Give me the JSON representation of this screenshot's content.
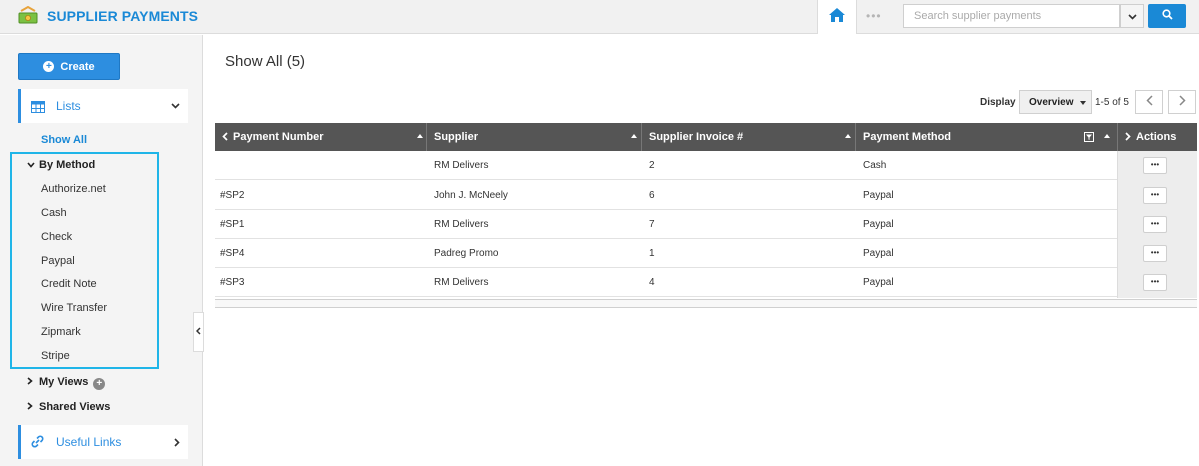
{
  "app": {
    "title": "SUPPLIER PAYMENTS",
    "logo_icon": "money-hand-icon"
  },
  "topbar": {
    "more_label": "•••",
    "search_placeholder": "Search supplier payments"
  },
  "sidebar": {
    "create_label": "Create",
    "lists_label": "Lists",
    "show_all_label": "Show All",
    "by_method_label": "By Method",
    "methods": [
      "Authorize.net",
      "Cash",
      "Check",
      "Paypal",
      "Credit Note",
      "Wire Transfer",
      "Zipmark",
      "Stripe"
    ],
    "my_views_label": "My Views",
    "shared_views_label": "Shared Views",
    "useful_links_label": "Useful Links"
  },
  "main": {
    "page_title": "Show All (5)",
    "display_label": "Display",
    "display_value": "Overview",
    "pager_text": "1-5 of 5"
  },
  "table": {
    "columns": [
      "Payment Number",
      "Supplier",
      "Supplier Invoice #",
      "Payment Method",
      "Actions"
    ],
    "rows": [
      {
        "payment_number": "",
        "supplier": "RM Delivers",
        "invoice": "2",
        "method": "Cash"
      },
      {
        "payment_number": "#SP2",
        "supplier": "John J. McNeely",
        "invoice": "6",
        "method": "Paypal"
      },
      {
        "payment_number": "#SP1",
        "supplier": "RM Delivers",
        "invoice": "7",
        "method": "Paypal"
      },
      {
        "payment_number": "#SP4",
        "supplier": "Padreg Promo",
        "invoice": "1",
        "method": "Paypal"
      },
      {
        "payment_number": "#SP3",
        "supplier": "RM Delivers",
        "invoice": "4",
        "method": "Paypal"
      }
    ],
    "action_label": "•••"
  },
  "colors": {
    "accent": "#1a89d6",
    "highlight_box": "#1fb5e8",
    "table_header": "#555555"
  }
}
